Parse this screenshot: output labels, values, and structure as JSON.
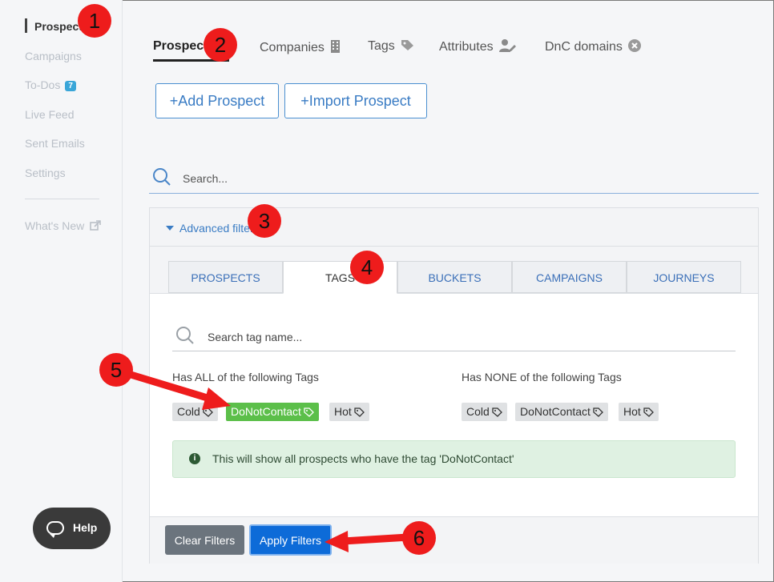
{
  "sidebar": {
    "items": [
      {
        "label": "Prospects"
      },
      {
        "label": "Campaigns"
      },
      {
        "label": "To-Dos",
        "badge": "7"
      },
      {
        "label": "Live Feed"
      },
      {
        "label": "Sent Emails"
      },
      {
        "label": "Settings"
      },
      {
        "label": "What's New"
      }
    ],
    "help_label": "Help"
  },
  "top_tabs": [
    {
      "label": "Prospects",
      "icon": ""
    },
    {
      "label": "Companies",
      "icon": "building-icon"
    },
    {
      "label": "Tags",
      "icon": "tag-icon"
    },
    {
      "label": "Attributes",
      "icon": "user-edit-icon"
    },
    {
      "label": "DnC domains",
      "icon": "close-circle-icon"
    }
  ],
  "actions": {
    "add_prospect": "+Add Prospect",
    "import_prospect": "+Import Prospect"
  },
  "search": {
    "placeholder": "Search..."
  },
  "advanced": {
    "toggle_label": "Advanced filters",
    "tabs": [
      "PROSPECTS",
      "TAGS",
      "BUCKETS",
      "CAMPAIGNS",
      "JOURNEYS"
    ],
    "active_tab": "TAGS",
    "tag_search_placeholder": "Search tag name...",
    "has_all_title": "Has ALL of the following Tags",
    "has_none_title": "Has NONE of the following Tags",
    "has_all_tags": [
      {
        "label": "Cold",
        "selected": false
      },
      {
        "label": "DoNotContact",
        "selected": true
      },
      {
        "label": "Hot",
        "selected": false
      }
    ],
    "has_none_tags": [
      {
        "label": "Cold",
        "selected": false
      },
      {
        "label": "DoNotContact",
        "selected": false
      },
      {
        "label": "Hot",
        "selected": false
      }
    ],
    "info_message": "This will show all prospects who have the tag 'DoNotContact'",
    "clear_label": "Clear Filters",
    "apply_label": "Apply Filters"
  },
  "callouts": [
    "1",
    "2",
    "3",
    "4",
    "5",
    "6"
  ],
  "colors": {
    "accent": "#3a7cc4",
    "selected_tag": "#5cbf4a",
    "callout": "#ee1c1c",
    "apply": "#0d6bd8"
  }
}
